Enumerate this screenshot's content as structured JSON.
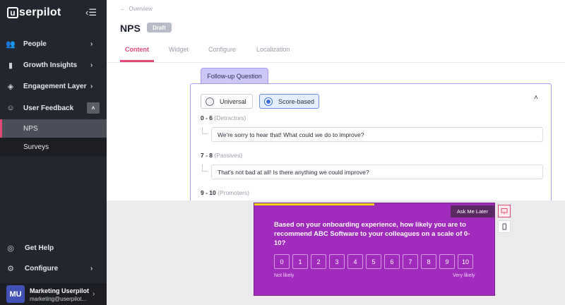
{
  "sidebar": {
    "logo": "userpilot",
    "items": [
      {
        "label": "People",
        "icon": "people-icon"
      },
      {
        "label": "Growth Insights",
        "icon": "bar-chart-icon"
      },
      {
        "label": "Engagement Layer",
        "icon": "layers-icon"
      },
      {
        "label": "User Feedback",
        "icon": "smiley-icon"
      }
    ],
    "sub_items": [
      "NPS",
      "Surveys"
    ],
    "bottom_items": [
      {
        "label": "Get Help",
        "icon": "help-icon"
      },
      {
        "label": "Configure",
        "icon": "gear-icon"
      }
    ],
    "user": {
      "initials": "MU",
      "name": "Marketing Userpilot",
      "email": "marketing@userpilot..."
    }
  },
  "header": {
    "back_label": "Overview",
    "title": "NPS",
    "status": "Draft",
    "tabs": [
      "Content",
      "Widget",
      "Configure",
      "Localization"
    ],
    "active_tab": "Content"
  },
  "content": {
    "section_tab": "Follow-up Question",
    "options": [
      "Universal",
      "Score-based"
    ],
    "selected_option": "Score-based",
    "groups": [
      {
        "range": "0 - 6",
        "group": "(Detractors)",
        "message": "We're sorry to hear that! What could we do to improve?"
      },
      {
        "range": "7 - 8",
        "group": "(Passives)",
        "message": "That's not bad at all! Is there anything we could improve?"
      },
      {
        "range": "9 - 10",
        "group": "(Promoters)"
      }
    ]
  },
  "preview": {
    "ask_later": "Ask Me Later",
    "question": "Based on your onboarding experience, how likely you are to recommend ABC Software to your colleagues on a scale of 0-10?",
    "scores": [
      "0",
      "1",
      "2",
      "3",
      "4",
      "5",
      "6",
      "7",
      "8",
      "9",
      "10"
    ],
    "low_label": "Not likely",
    "high_label": "Very likely",
    "progress": 0.5,
    "colors": {
      "background": "#a12bbd",
      "progress": "#f4d21c",
      "accent": "#e14a76"
    }
  }
}
